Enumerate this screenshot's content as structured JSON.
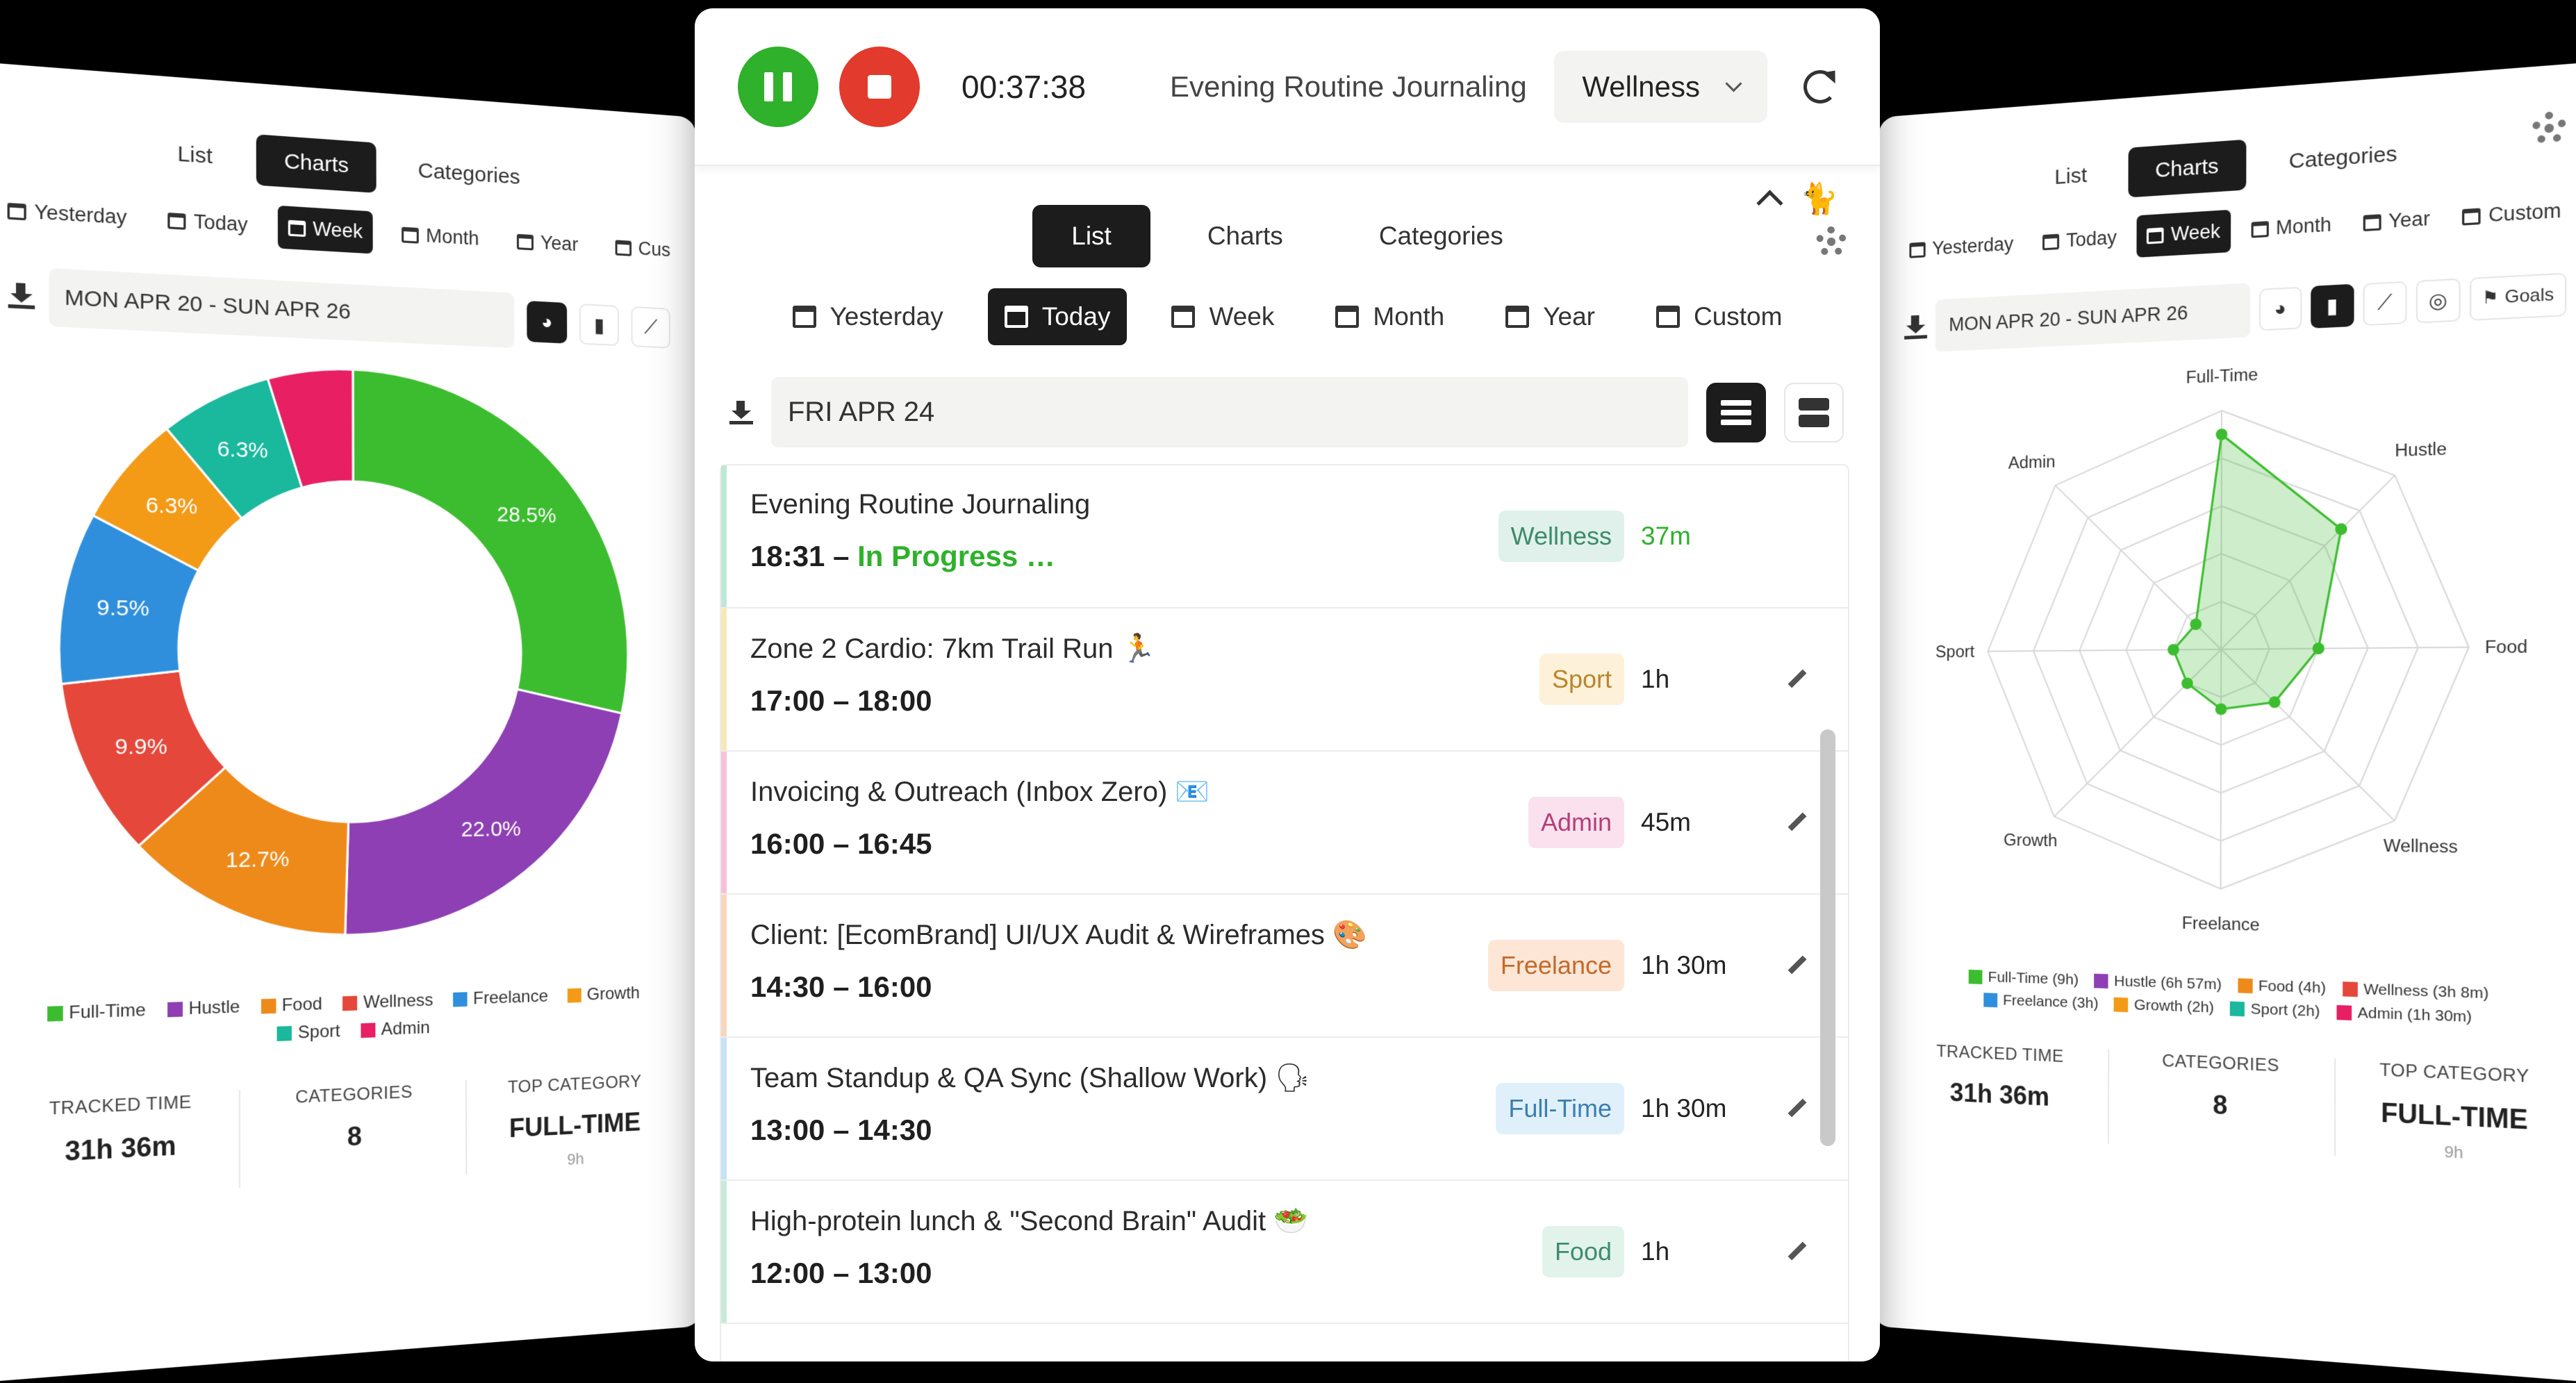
{
  "left": {
    "tabs": [
      "List",
      "Charts",
      "Categories"
    ],
    "active_tab": "Charts",
    "ranges": [
      "Yesterday",
      "Today",
      "Week",
      "Month",
      "Year",
      "Cus"
    ],
    "active_range": "Week",
    "date_range": "MON APR 20 - SUN APR 26",
    "stats": {
      "tracked_label": "TRACKED TIME",
      "tracked_value": "31h 36m",
      "categories_label": "CATEGORIES",
      "categories_value": "8",
      "top_label": "TOP CATEGORY",
      "top_value": "FULL-TIME",
      "top_sub": "9h"
    }
  },
  "center": {
    "timer": "00:37:38",
    "current_title": "Evening Routine Journaling",
    "category_select": "Wellness",
    "tabs": [
      "List",
      "Charts",
      "Categories"
    ],
    "active_tab": "List",
    "ranges": [
      "Yesterday",
      "Today",
      "Week",
      "Month",
      "Year",
      "Custom"
    ],
    "active_range": "Today",
    "date": "FRI APR 24",
    "entries": [
      {
        "title": "Evening Routine Journaling",
        "time": "18:31 – ",
        "status": "In Progress …",
        "tag": "Wellness",
        "duration": "37m",
        "tag_bg": "#dff1ea",
        "tag_fg": "#3e8a6b",
        "bar": "#bfe7d7",
        "dur_color": "#2fb12b"
      },
      {
        "title": "Zone 2 Cardio: 7km Trail Run 🏃",
        "time": "17:00 – 18:00",
        "tag": "Sport",
        "duration": "1h",
        "tag_bg": "#fdf1d9",
        "tag_fg": "#b8862c",
        "bar": "#f8e7b8",
        "dur_color": "#222"
      },
      {
        "title": "Invoicing & Outreach (Inbox Zero) 📧",
        "time": "16:00 – 16:45",
        "tag": "Admin",
        "duration": "45m",
        "tag_bg": "#fbe1ee",
        "tag_fg": "#b43e7a",
        "bar": "#f5c2dc",
        "dur_color": "#222"
      },
      {
        "title": "Client: [EcomBrand] UI/UX Audit & Wireframes 🎨",
        "time": "14:30 – 16:00",
        "tag": "Freelance",
        "duration": "1h 30m",
        "tag_bg": "#fde6d6",
        "tag_fg": "#c26a2b",
        "bar": "#f8d6bd",
        "dur_color": "#222"
      },
      {
        "title": "Team Standup & QA Sync (Shallow Work) 🗣",
        "time": "13:00 – 14:30",
        "tag": "Full-Time",
        "duration": "1h 30m",
        "tag_bg": "#e0f0fb",
        "tag_fg": "#3a7fb0",
        "bar": "#c6e3f6",
        "dur_color": "#222"
      },
      {
        "title": "High-protein lunch & \"Second Brain\" Audit 🥗",
        "time": "12:00 – 13:00",
        "tag": "Food",
        "duration": "1h",
        "tag_bg": "#e2f3ec",
        "tag_fg": "#3f8c6a",
        "bar": "#c9eadb",
        "dur_color": "#222"
      }
    ]
  },
  "right": {
    "tabs": [
      "List",
      "Charts",
      "Categories"
    ],
    "active_tab": "Charts",
    "ranges": [
      "Yesterday",
      "Today",
      "Week",
      "Month",
      "Year",
      "Custom"
    ],
    "active_range": "Week",
    "date_range": "MON APR 20 - SUN APR 26",
    "goals_label": "Goals",
    "stats": {
      "tracked_label": "TRACKED TIME",
      "tracked_value": "31h 36m",
      "categories_label": "CATEGORIES",
      "categories_value": "8",
      "top_label": "TOP CATEGORY",
      "top_value": "FULL-TIME",
      "top_sub": "9h"
    }
  },
  "chart_data": [
    {
      "type": "pie",
      "categories": [
        "Full-Time",
        "Hustle",
        "Food",
        "Wellness",
        "Freelance",
        "Growth",
        "Sport",
        "Admin"
      ],
      "values": [
        28.5,
        22.0,
        12.7,
        9.9,
        9.5,
        6.3,
        6.3,
        4.8
      ],
      "data_labels": [
        "28.5%",
        "22.0%",
        "12.7%",
        "9.9%",
        "9.5%",
        "6.3%",
        "6.3%",
        ""
      ],
      "colors": [
        "#3cbd2f",
        "#8e3fb3",
        "#ee8a1a",
        "#e5473a",
        "#2f8fdc",
        "#f39a17",
        "#1ab89c",
        "#e81f63"
      ],
      "legend": [
        "Full-Time",
        "Hustle",
        "Food",
        "Wellness",
        "Freelance",
        "Growth",
        "Sport",
        "Admin"
      ],
      "legend_position": "bottom"
    },
    {
      "type": "radar",
      "axes": [
        "Full-Time",
        "Hustle",
        "Food",
        "Wellness",
        "Freelance",
        "Growth",
        "Sport",
        "Admin"
      ],
      "values": [
        9,
        6.95,
        4,
        3.13,
        2.5,
        2,
        2,
        1.5
      ],
      "rmax": 10,
      "color": "#3cbd2f",
      "legend": [
        "Full-Time (9h)",
        "Hustle (6h 57m)",
        "Food (4h)",
        "Wellness (3h 8m)",
        "Freelance (3h)",
        "Growth (2h)",
        "Sport (2h)",
        "Admin (1h 30m)"
      ],
      "legend_colors": [
        "#3cbd2f",
        "#8e3fb3",
        "#ee8a1a",
        "#e5473a",
        "#2f8fdc",
        "#f39a17",
        "#1ab89c",
        "#e81f63"
      ],
      "legend_position": "bottom"
    }
  ]
}
